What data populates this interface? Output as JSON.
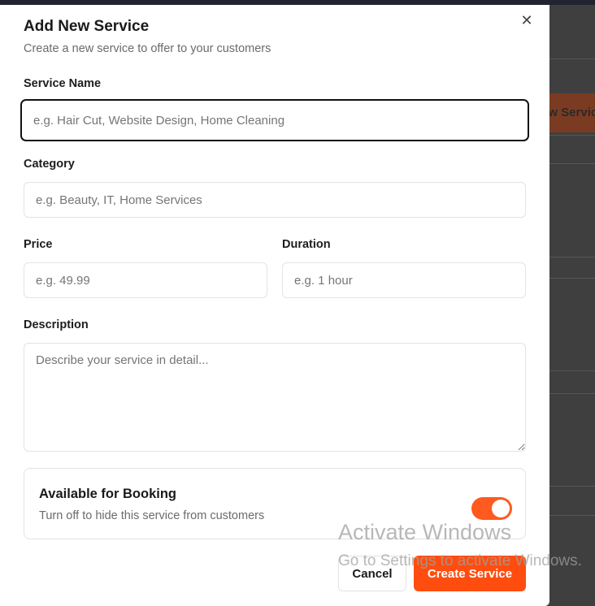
{
  "background": {
    "button_label": "ew Servic"
  },
  "modal": {
    "title": "Add New Service",
    "subtitle": "Create a new service to offer to your customers",
    "close_icon": "close-icon"
  },
  "form": {
    "service_name": {
      "label": "Service Name",
      "placeholder": "e.g. Hair Cut, Website Design, Home Cleaning",
      "value": ""
    },
    "category": {
      "label": "Category",
      "placeholder": "e.g. Beauty, IT, Home Services",
      "value": ""
    },
    "price": {
      "label": "Price",
      "placeholder": "e.g. 49.99",
      "value": ""
    },
    "duration": {
      "label": "Duration",
      "placeholder": "e.g. 1 hour",
      "value": ""
    },
    "description": {
      "label": "Description",
      "placeholder": "Describe your service in detail...",
      "value": ""
    }
  },
  "availability": {
    "title": "Available for Booking",
    "description": "Turn off to hide this service from customers",
    "enabled": true
  },
  "actions": {
    "cancel_label": "Cancel",
    "create_label": "Create Service"
  },
  "watermark": {
    "title": "Activate Windows",
    "subtitle": "Go to Settings to activate Windows."
  },
  "colors": {
    "accent": "#ff4d0f",
    "toggle_on": "#ff5a1f"
  }
}
